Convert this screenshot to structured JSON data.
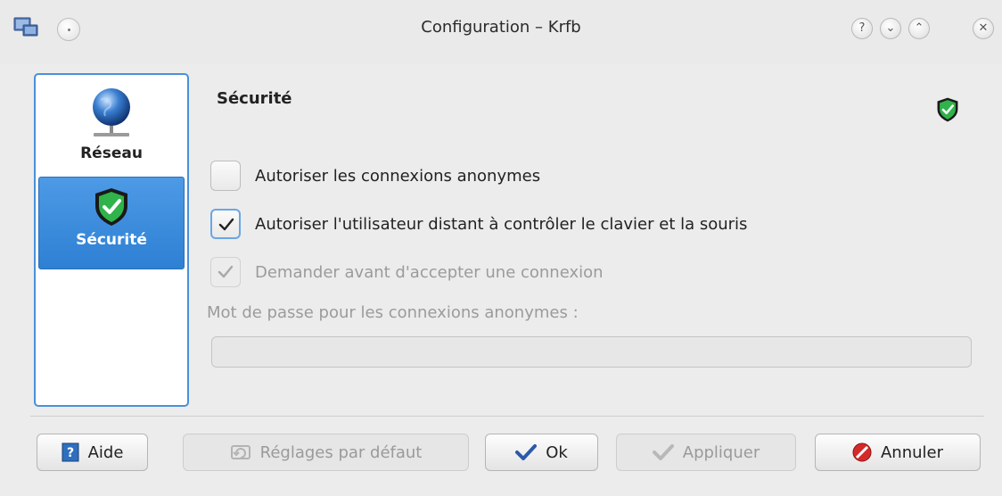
{
  "window": {
    "title": "Configuration – Krfb"
  },
  "titlebar_buttons": [
    {
      "name": "help-button",
      "glyph": "?"
    },
    {
      "name": "minimize-button",
      "glyph": "⌄"
    },
    {
      "name": "maximize-button",
      "glyph": "⌃"
    },
    {
      "name": "close-button",
      "glyph": "✕"
    }
  ],
  "sidebar": {
    "items": [
      {
        "label": "Réseau",
        "icon": "globe-network-icon",
        "selected": false
      },
      {
        "label": "Sécurité",
        "icon": "shield-icon",
        "selected": true
      }
    ]
  },
  "main": {
    "section_title": "Sécurité",
    "options": [
      {
        "label": "Autoriser les connexions anonymes",
        "checked": false,
        "enabled": true
      },
      {
        "label": "Autoriser l'utilisateur distant à contrôler le clavier et la souris",
        "checked": true,
        "enabled": true
      },
      {
        "label": "Demander avant d'accepter une connexion",
        "checked": true,
        "enabled": false
      }
    ],
    "password_label": "Mot de passe pour les connexions anonymes :",
    "password_value": ""
  },
  "buttons": {
    "help": "Aide",
    "defaults": "Réglages par défaut",
    "ok": "Ok",
    "apply": "Appliquer",
    "cancel": "Annuler"
  },
  "colors": {
    "accent": "#3a8ee0",
    "shield_green": "#2fb34a",
    "cancel_red": "#d42a2a"
  }
}
